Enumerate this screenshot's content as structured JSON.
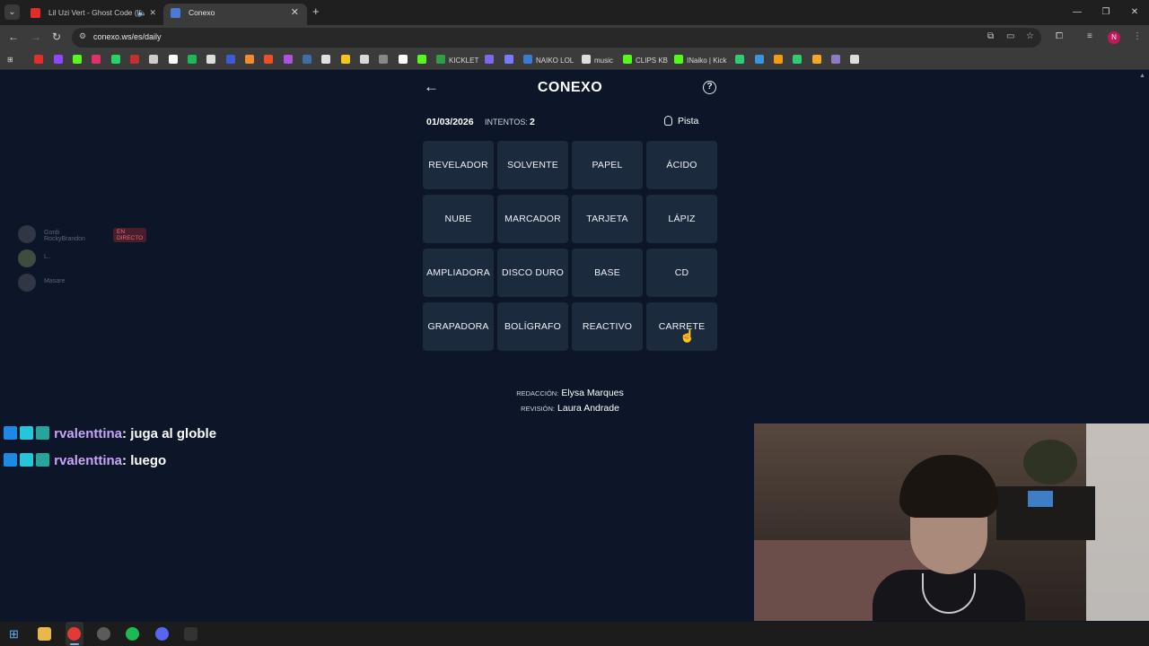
{
  "browser": {
    "tabs": [
      {
        "title": "Lil Uzi Vert - Ghost Code (le",
        "active": false
      },
      {
        "title": "Conexo",
        "active": true
      }
    ],
    "url": "conexo.ws/es/daily",
    "bookmarks": [
      "KICKLET",
      "NAIKO LOL",
      "music",
      "CLIPS KB",
      "INaiko | Kick"
    ],
    "profile_initial": "N"
  },
  "game": {
    "title": "CONEXO",
    "date": "01/03/2026",
    "attempts_label": "INTENTOS:",
    "attempts": "2",
    "hint_label": "Pista",
    "words": [
      "REVELADOR",
      "SOLVENTE",
      "PAPEL",
      "ÁCIDO",
      "NUBE",
      "MARCADOR",
      "TARJETA",
      "LÁPIZ",
      "AMPLIADORA",
      "DISCO DURO",
      "BASE",
      "CD",
      "GRAPADORA",
      "BOLÍGRAFO",
      "REACTIVO",
      "CARRETE"
    ],
    "credits": {
      "editor_label": "REDACCIÓN:",
      "editor": "Elysa Marques",
      "reviewer_label": "REVISIÓN:",
      "reviewer": "Laura Andrade"
    }
  },
  "voice_overlay": {
    "users": [
      {
        "name": "Gordi RockyBrandon",
        "badge": "EN DIRECTO"
      },
      {
        "name": "L..",
        "badge": ""
      },
      {
        "name": "Masare",
        "badge": ""
      }
    ]
  },
  "chat": {
    "messages": [
      {
        "user": "rvalenttina",
        "text": ": juga al globle"
      },
      {
        "user": "rvalenttina",
        "text": ": luego"
      }
    ]
  },
  "colors": {
    "page_bg": "#0d1629",
    "card_bg": "#1c2a3d",
    "chat_username": "#c9a5f7"
  }
}
